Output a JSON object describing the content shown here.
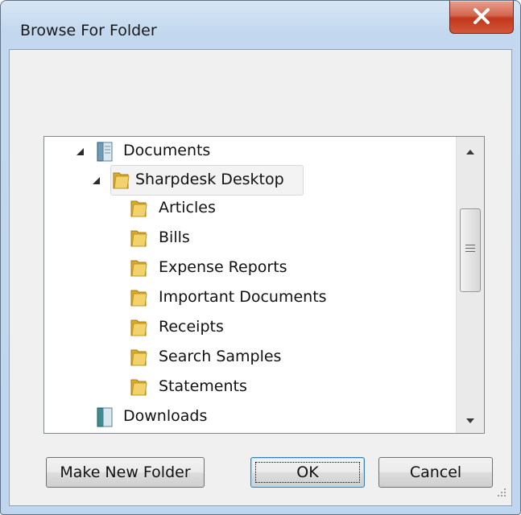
{
  "window": {
    "title": "Browse For Folder"
  },
  "tree": {
    "items": [
      {
        "label": "Documents",
        "kind": "library",
        "level": 1,
        "expanded": true
      },
      {
        "label": "Sharpdesk Desktop",
        "kind": "folder",
        "level": 2,
        "expanded": true,
        "selected": true
      },
      {
        "label": "Articles",
        "kind": "folder",
        "level": 3
      },
      {
        "label": "Bills",
        "kind": "folder",
        "level": 3
      },
      {
        "label": "Expense Reports",
        "kind": "folder",
        "level": 3
      },
      {
        "label": "Important Documents",
        "kind": "folder",
        "level": 3
      },
      {
        "label": "Receipts",
        "kind": "folder",
        "level": 3
      },
      {
        "label": "Search Samples",
        "kind": "folder",
        "level": 3
      },
      {
        "label": "Statements",
        "kind": "folder",
        "level": 3
      },
      {
        "label": "Downloads",
        "kind": "library",
        "level": 1
      }
    ]
  },
  "buttons": {
    "make_new_folder": "Make New Folder",
    "ok": "OK",
    "cancel": "Cancel"
  },
  "colors": {
    "folder_yellow": "#e8c14a",
    "selection_border": "#d9d9d9",
    "default_button_border": "#3c7fb1",
    "close_button_red": "#c2371a"
  },
  "icons": {
    "close": "close-icon",
    "folder": "folder-icon",
    "library": "library-icon",
    "expander": "expand-triangle-icon"
  }
}
